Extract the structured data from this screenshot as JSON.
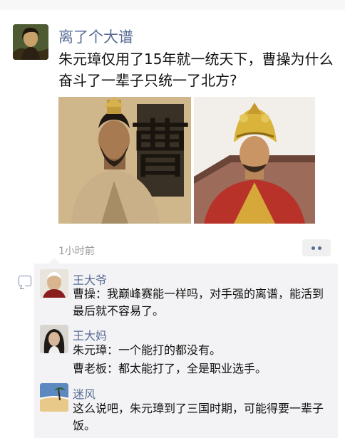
{
  "post": {
    "author": "离了个大谱",
    "text": "朱元璋仅用了15年就一统天下，曹操为什么奋斗了一辈子只统一了北方?",
    "time": "1小时前",
    "photo_left_char": "曹"
  },
  "comments": [
    {
      "author": "王大爷",
      "lines": [
        "曹操：我巅峰赛能一样吗，对手强的离谱，能活到最后就不容易了。"
      ]
    },
    {
      "author": "王大妈",
      "lines": [
        "朱元璋：一个能打的都没有。",
        "曹老板：都太能打了，全是职业选手。"
      ]
    },
    {
      "author": "迷风",
      "lines": [
        "这么说吧，朱元璋到了三国时期，可能得要一辈子饭。"
      ]
    }
  ],
  "colors": {
    "name_link": "#576b95",
    "comment_bg": "#f3f3f5",
    "time_gray": "#9a9a9a"
  },
  "icons": {
    "more": "more-dots-icon",
    "comment": "comment-bubble-icon"
  }
}
